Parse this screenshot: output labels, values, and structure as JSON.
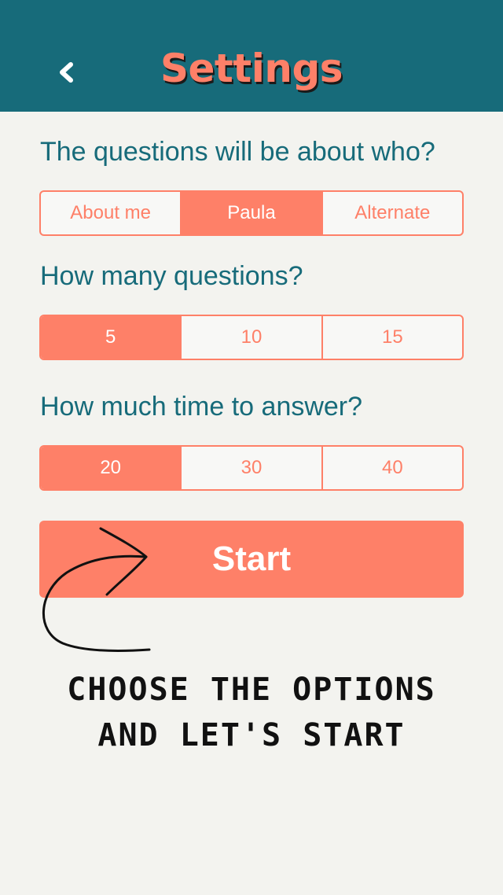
{
  "header": {
    "title": "Settings",
    "back_icon": "chevron-left-icon"
  },
  "colors": {
    "header_bg": "#176b7a",
    "accent": "#fe8068",
    "background": "#f3f3ef"
  },
  "sections": {
    "who": {
      "question": "The questions will be about who?",
      "options": [
        "About me",
        "Paula",
        "Alternate"
      ],
      "selected": "Paula"
    },
    "count": {
      "question": "How many questions?",
      "options": [
        "5",
        "10",
        "15"
      ],
      "selected": "5"
    },
    "time": {
      "question": "How much time to answer?",
      "options": [
        "20",
        "30",
        "40"
      ],
      "selected": "20"
    }
  },
  "start_label": "Start",
  "hint": {
    "line1": "CHOOSE THE OPTIONS",
    "line2": "AND LET'S START"
  }
}
